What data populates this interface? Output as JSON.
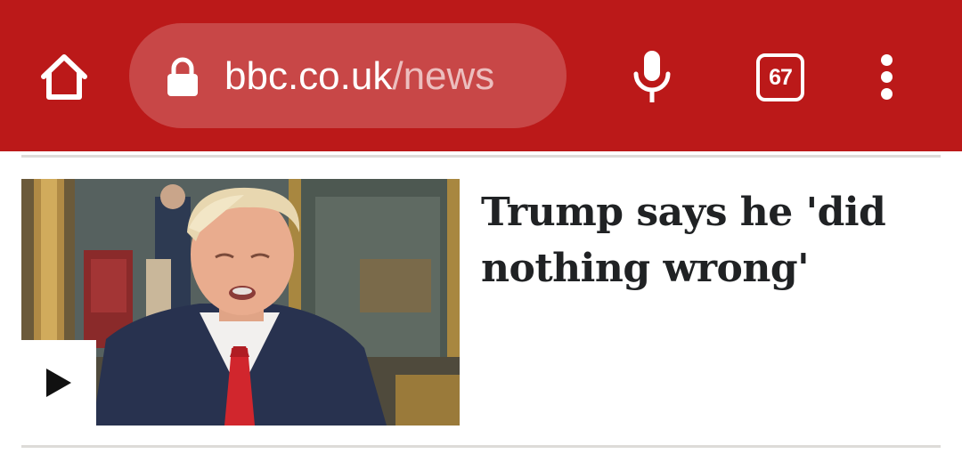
{
  "browser": {
    "url_domain": "bbc.co.uk",
    "url_path": "/news",
    "tab_count": "67",
    "icons": {
      "home": "home-icon",
      "lock": "lock-icon",
      "mic": "microphone-icon",
      "tabs": "tab-switcher-icon",
      "menu": "more-vertical-icon"
    },
    "toolbar_color": "#bb1919"
  },
  "story": {
    "headline": "Trump says he 'did nothing wrong'",
    "media_type": "video",
    "play_icon": "play-icon"
  }
}
